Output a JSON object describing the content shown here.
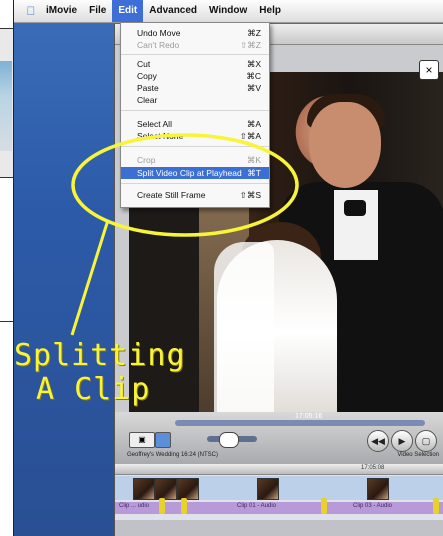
{
  "menubar": {
    "apple_icon": "apple-icon",
    "items": [
      "iMovie",
      "File",
      "Edit",
      "Advanced",
      "Window",
      "Help"
    ],
    "active_item": "Edit"
  },
  "edit_menu": {
    "undo": {
      "label": "Undo Move",
      "shortcut": "⌘Z"
    },
    "redo": {
      "label": "Can't Redo",
      "shortcut": "⇧⌘Z"
    },
    "cut": {
      "label": "Cut",
      "shortcut": "⌘X"
    },
    "copy": {
      "label": "Copy",
      "shortcut": "⌘C"
    },
    "paste": {
      "label": "Paste",
      "shortcut": "⌘V"
    },
    "clear": {
      "label": "Clear",
      "shortcut": ""
    },
    "select_all": {
      "label": "Select All",
      "shortcut": "⌘A"
    },
    "select_none": {
      "label": "Select None",
      "shortcut": "⇧⌘A"
    },
    "crop": {
      "label": "Crop",
      "shortcut": "⌘K"
    },
    "split": {
      "label": "Split Video Clip at Playhead",
      "shortcut": "⌘T"
    },
    "still": {
      "label": "Create Still Frame",
      "shortcut": "⇧⌘S"
    }
  },
  "annotation": {
    "line1": "Splitting",
    "line2": "A Clip",
    "color": "#f7f43a"
  },
  "controls": {
    "scrubber_time": "17:05:16",
    "project_info": "Geoffrey's Wedding  16:24 (NTSC)",
    "video_label": "Video Selection",
    "ruler_time": "17:05:08"
  },
  "timeline": {
    "audio_clips": [
      "Clip ... udio",
      "Clip 01 - Audio",
      "Clip 03 - Audio"
    ]
  }
}
